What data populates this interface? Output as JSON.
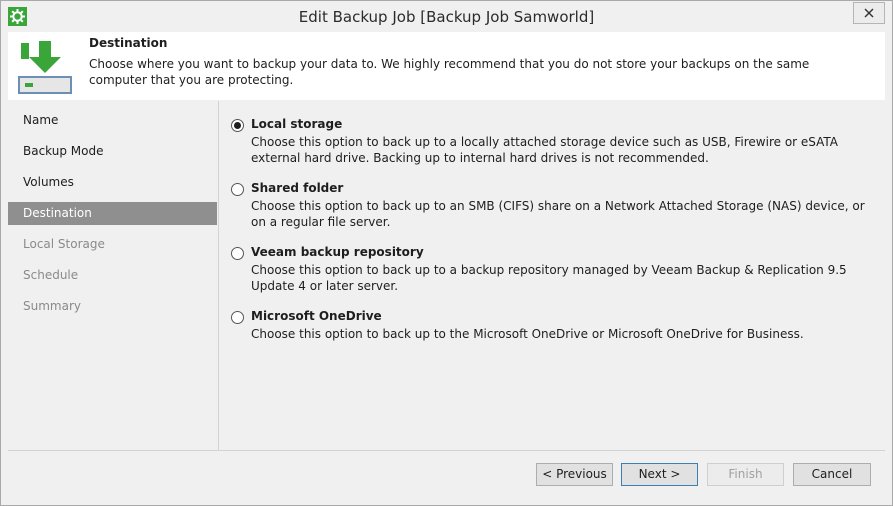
{
  "window": {
    "title": "Edit Backup Job [Backup Job Samworld]",
    "close_label": "✕"
  },
  "header": {
    "title": "Destination",
    "description": "Choose where you want to backup your data to. We highly recommend that you do not store your backups on the same computer that you are protecting."
  },
  "sidebar": {
    "items": [
      {
        "label": "Name",
        "state": "normal"
      },
      {
        "label": "Backup Mode",
        "state": "normal"
      },
      {
        "label": "Volumes",
        "state": "normal"
      },
      {
        "label": "Destination",
        "state": "active"
      },
      {
        "label": "Local Storage",
        "state": "disabled"
      },
      {
        "label": "Schedule",
        "state": "disabled"
      },
      {
        "label": "Summary",
        "state": "disabled"
      }
    ]
  },
  "options": [
    {
      "title": "Local storage",
      "description": "Choose this option to back up to a locally attached storage device such as USB, Firewire or eSATA external hard drive. Backing up to internal hard drives is not recommended.",
      "checked": true
    },
    {
      "title": "Shared folder",
      "description": "Choose this option to back up to an SMB (CIFS) share on a Network Attached Storage (NAS) device, or on a regular file server.",
      "checked": false
    },
    {
      "title": "Veeam backup repository",
      "description": "Choose this option to back up to a backup repository managed by Veeam Backup & Replication 9.5 Update 4 or later server.",
      "checked": false
    },
    {
      "title": "Microsoft OneDrive",
      "description": "Choose this option to back up to the Microsoft OneDrive or Microsoft OneDrive for Business.",
      "checked": false
    }
  ],
  "buttons": {
    "previous": "< Previous",
    "next": "Next >",
    "finish": "Finish",
    "cancel": "Cancel"
  },
  "colors": {
    "accent_green": "#3aa63a",
    "active_nav": "#8f8f8f",
    "primary_border": "#3c7fb1"
  },
  "icons": {
    "app": "veeam-gear-icon",
    "header": "download-to-drive-icon",
    "close": "close-icon"
  }
}
